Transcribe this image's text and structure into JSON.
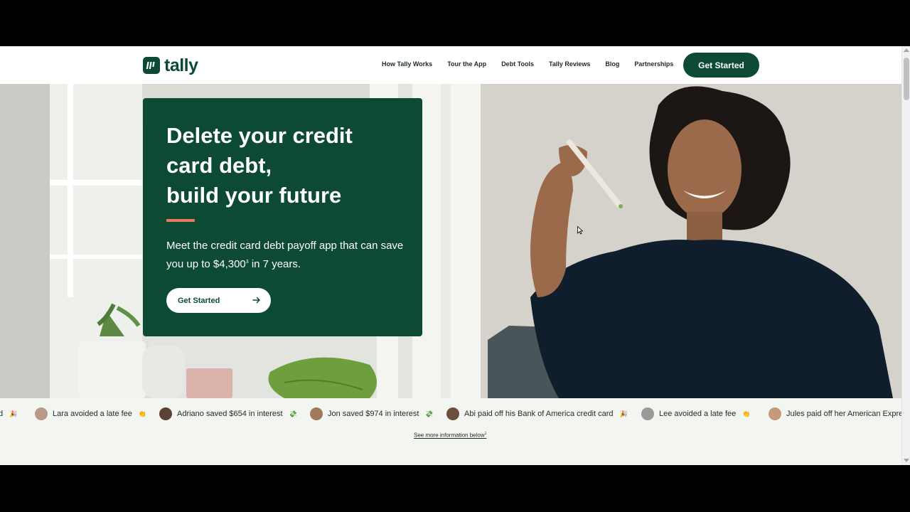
{
  "brand": {
    "name": "tally",
    "color": "#0d4a33",
    "accent": "#ef7763"
  },
  "nav": {
    "items": [
      "How Tally Works",
      "Tour the App",
      "Debt Tools",
      "Tally Reviews",
      "Blog",
      "Partnerships"
    ],
    "cta_label": "Get Started"
  },
  "hero": {
    "title_lines": [
      "Delete your credit",
      "card debt,",
      "build your future"
    ],
    "subtitle_text": "Meet the credit card debt payoff app that can save you up to $4,300",
    "subtitle_footnote": "3",
    "subtitle_suffix": " in 7 years.",
    "cta_label": "Get Started",
    "cta_icon": "arrow-right-icon"
  },
  "ticker": {
    "items": [
      {
        "text": "d",
        "emoji": "🎉",
        "avatar_color": ""
      },
      {
        "text": "Lara avoided a late fee",
        "emoji": "👏",
        "avatar_color": "#b89a86"
      },
      {
        "text": "Adriano saved $654 in interest",
        "emoji": "💸",
        "avatar_color": "#5a4336"
      },
      {
        "text": "Jon saved $974 in interest",
        "emoji": "💸",
        "avatar_color": "#a07a5c"
      },
      {
        "text": "Abi paid off his Bank of America credit card",
        "emoji": "🎉",
        "avatar_color": "#6b4f3a"
      },
      {
        "text": "Lee avoided a late fee",
        "emoji": "👏",
        "avatar_color": "#9a9a9a"
      },
      {
        "text": "Jules paid off her American Express",
        "emoji": "",
        "avatar_color": "#c49a78"
      }
    ],
    "see_more_label": "See more information below",
    "see_more_footnote": "1"
  }
}
